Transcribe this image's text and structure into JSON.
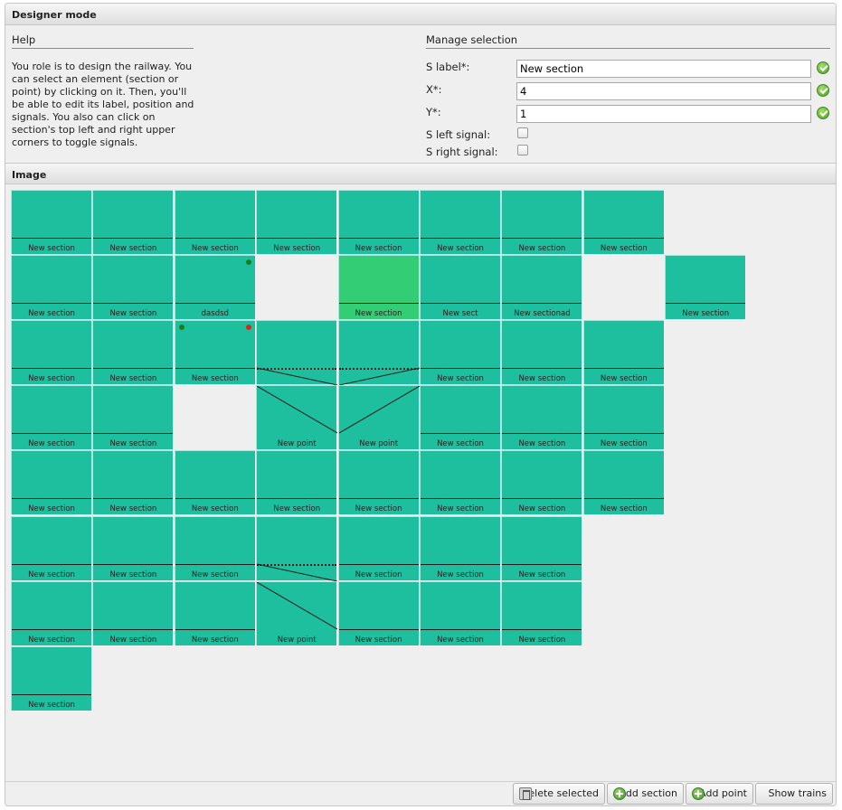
{
  "header": {
    "title": "Designer mode"
  },
  "help": {
    "title": "Help",
    "lines": [
      "You role is to design the railway. You",
      "can select an element (section or",
      "point) by clicking on it. Then, you'll",
      "be able to edit its label, position and",
      "signals. You also can click on",
      "section's top left and right upper",
      "corners to toggle signals."
    ]
  },
  "manage": {
    "title": "Manage selection",
    "label_label": "S label*:",
    "label_value": "New section",
    "x_label": "X*:",
    "x_value": "4",
    "y_label": "Y*:",
    "y_value": "1",
    "left_signal_label": "S left signal:",
    "left_signal_checked": false,
    "right_signal_label": "S right signal:",
    "right_signal_checked": false
  },
  "image_header": {
    "title": "Image"
  },
  "grid": {
    "cells": [
      {
        "col": 0,
        "row": 0,
        "type": "section",
        "label": "New section"
      },
      {
        "col": 1,
        "row": 0,
        "type": "section",
        "label": "New section"
      },
      {
        "col": 2,
        "row": 0,
        "type": "section",
        "label": "New section"
      },
      {
        "col": 3,
        "row": 0,
        "type": "section",
        "label": "New section"
      },
      {
        "col": 4,
        "row": 0,
        "type": "section",
        "label": "New section"
      },
      {
        "col": 5,
        "row": 0,
        "type": "section",
        "label": "New section"
      },
      {
        "col": 6,
        "row": 0,
        "type": "section",
        "label": "New section"
      },
      {
        "col": 7,
        "row": 0,
        "type": "section",
        "label": "New section"
      },
      {
        "col": 0,
        "row": 1,
        "type": "section",
        "label": "New section"
      },
      {
        "col": 1,
        "row": 1,
        "type": "section",
        "label": "New section"
      },
      {
        "col": 2,
        "row": 1,
        "type": "section",
        "label": "dasdsd",
        "signal_right": "green"
      },
      {
        "col": 4,
        "row": 1,
        "type": "section",
        "label": "New section",
        "selected": true
      },
      {
        "col": 5,
        "row": 1,
        "type": "section",
        "label": "New sect"
      },
      {
        "col": 6,
        "row": 1,
        "type": "section",
        "label": "New sectionad"
      },
      {
        "col": 8,
        "row": 1,
        "type": "section",
        "label": "New section"
      },
      {
        "col": 0,
        "row": 2,
        "type": "section",
        "label": "New section"
      },
      {
        "col": 1,
        "row": 2,
        "type": "section",
        "label": "New section"
      },
      {
        "col": 2,
        "row": 2,
        "type": "section",
        "label": "New section",
        "signal_left": "green",
        "signal_right": "red"
      },
      {
        "col": 3,
        "row": 2,
        "type": "point_top",
        "direction": "down-right",
        "label": ""
      },
      {
        "col": 4,
        "row": 2,
        "type": "point_top",
        "direction": "down-left",
        "label": ""
      },
      {
        "col": 5,
        "row": 2,
        "type": "section",
        "label": "New section"
      },
      {
        "col": 6,
        "row": 2,
        "type": "section",
        "label": "New section"
      },
      {
        "col": 7,
        "row": 2,
        "type": "section",
        "label": "New section"
      },
      {
        "col": 0,
        "row": 3,
        "type": "section",
        "label": "New section"
      },
      {
        "col": 1,
        "row": 3,
        "type": "section",
        "label": "New section"
      },
      {
        "col": 3,
        "row": 3,
        "type": "point_bottom",
        "direction": "down-right",
        "label": "New point"
      },
      {
        "col": 4,
        "row": 3,
        "type": "point_bottom",
        "direction": "up-right",
        "label": "New point"
      },
      {
        "col": 5,
        "row": 3,
        "type": "section",
        "label": "New section"
      },
      {
        "col": 6,
        "row": 3,
        "type": "section",
        "label": "New section"
      },
      {
        "col": 7,
        "row": 3,
        "type": "section",
        "label": "New section"
      },
      {
        "col": 0,
        "row": 4,
        "type": "section",
        "label": "New section"
      },
      {
        "col": 1,
        "row": 4,
        "type": "section",
        "label": "New section"
      },
      {
        "col": 2,
        "row": 4,
        "type": "section",
        "label": "New section"
      },
      {
        "col": 3,
        "row": 4,
        "type": "section",
        "label": "New section"
      },
      {
        "col": 4,
        "row": 4,
        "type": "section",
        "label": "New section"
      },
      {
        "col": 5,
        "row": 4,
        "type": "section",
        "label": "New section"
      },
      {
        "col": 6,
        "row": 4,
        "type": "section",
        "label": "New section"
      },
      {
        "col": 7,
        "row": 4,
        "type": "section",
        "label": "New section"
      },
      {
        "col": 0,
        "row": 5,
        "type": "section",
        "label": "New section"
      },
      {
        "col": 1,
        "row": 5,
        "type": "section",
        "label": "New section"
      },
      {
        "col": 2,
        "row": 5,
        "type": "section",
        "label": "New section"
      },
      {
        "col": 3,
        "row": 5,
        "type": "point_top",
        "direction": "down-right",
        "label": ""
      },
      {
        "col": 4,
        "row": 5,
        "type": "section",
        "label": "New section"
      },
      {
        "col": 5,
        "row": 5,
        "type": "section",
        "label": "New section"
      },
      {
        "col": 6,
        "row": 5,
        "type": "section",
        "label": "New section"
      },
      {
        "col": 0,
        "row": 6,
        "type": "section",
        "label": "New section"
      },
      {
        "col": 1,
        "row": 6,
        "type": "section",
        "label": "New section"
      },
      {
        "col": 2,
        "row": 6,
        "type": "section",
        "label": "New section"
      },
      {
        "col": 3,
        "row": 6,
        "type": "point_bottom",
        "direction": "down-right",
        "label": "New point"
      },
      {
        "col": 4,
        "row": 6,
        "type": "section",
        "label": "New section"
      },
      {
        "col": 5,
        "row": 6,
        "type": "section",
        "label": "New section"
      },
      {
        "col": 6,
        "row": 6,
        "type": "section",
        "label": "New section"
      },
      {
        "col": 0,
        "row": 7,
        "type": "section",
        "label": "New section"
      }
    ]
  },
  "footer": {
    "delete_label": "Delete selected",
    "add_section_label": "Add section",
    "add_point_label": "Add point",
    "show_trains_label": "Show trains"
  }
}
